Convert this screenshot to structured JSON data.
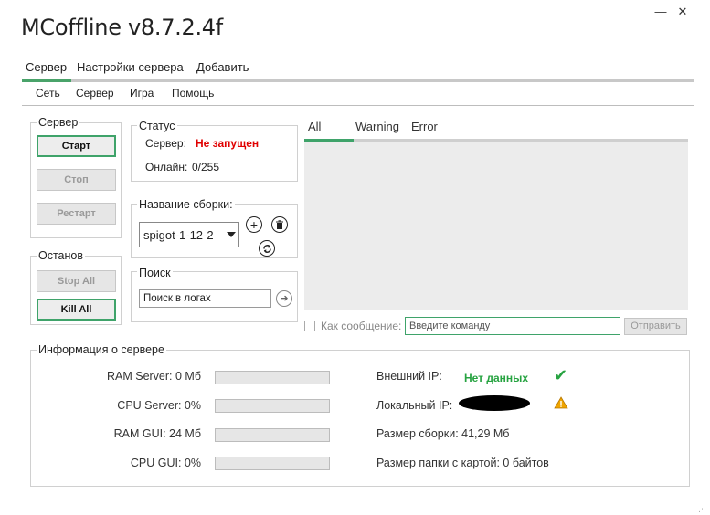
{
  "window": {
    "title": "MCoffline v8.7.2.4f",
    "minimize": "—",
    "close": "✕"
  },
  "top_menu": {
    "items": [
      "Сервер",
      "Настройки сервера",
      "Добавить"
    ]
  },
  "sub_menu": {
    "items": [
      "Сеть",
      "Сервер",
      "Игра",
      "Помощь"
    ]
  },
  "server_group": {
    "title": "Сервер",
    "start": "Старт",
    "stop": "Стоп",
    "restart": "Рестарт"
  },
  "stop_group": {
    "title": "Останов",
    "stop_all": "Stop All",
    "kill_all": "Kill All"
  },
  "status_group": {
    "title": "Статус",
    "server_label": "Сервер:",
    "server_value": "Не запущен",
    "online_label": "Онлайн:",
    "online_value": "0/255"
  },
  "build_group": {
    "title": "Название сборки:",
    "selected": "spigot-1-12-2"
  },
  "search_group": {
    "title": "Поиск",
    "value": "Поиск в логах"
  },
  "log": {
    "tabs": [
      "All",
      "Warning",
      "Error"
    ],
    "as_message_label": "Как сообщение:",
    "command_placeholder": "Введите команду",
    "send": "Отправить"
  },
  "info_group": {
    "title": "Информация о сервере",
    "ram_server": "RAM Server: 0 Мб",
    "cpu_server": "CPU Server: 0%",
    "ram_gui": "RAM GUI: 24 Мб",
    "cpu_gui": "CPU GUI: 0%",
    "ram_server_progress": 0,
    "cpu_server_progress": 0,
    "ram_gui_progress": 0,
    "cpu_gui_progress": 0,
    "external_ip_label": "Внешний IP:",
    "external_ip_value": "Нет данных",
    "local_ip_label": "Локальный IP:",
    "build_size": "Размер сборки: 41,29 Мб",
    "map_folder_size": "Размер папки с картой: 0 байтов"
  },
  "colors": {
    "accent": "#3fa36a",
    "error": "#e00000",
    "ok": "#27a341",
    "warning": "#f0a500"
  }
}
